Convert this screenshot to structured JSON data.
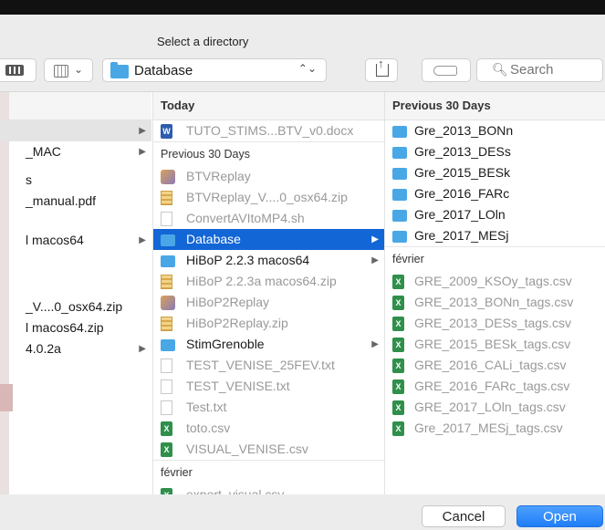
{
  "dialog": {
    "title": "Select a directory"
  },
  "toolbar": {
    "path_label": "Database",
    "search_placeholder": "Search",
    "updown_glyph": "⌃⌄"
  },
  "sidebar": {
    "rows": [
      {
        "label": "",
        "arrow": true
      },
      {
        "label": "_MAC",
        "arrow": true
      },
      {
        "label": "s",
        "arrow": false
      },
      {
        "label": "_manual.pdf",
        "arrow": false
      },
      {
        "label": "l macos64",
        "arrow": true
      },
      {
        "label": "_V....0_osx64.zip",
        "arrow": false
      },
      {
        "label": "l macos64.zip",
        "arrow": false
      },
      {
        "label": "4.0.2a",
        "arrow": true
      }
    ]
  },
  "column1": {
    "header": "Today",
    "today_items": [
      {
        "label": "TUTO_STIMS...BTV_v0.docx",
        "icon": "word-doc-icon",
        "dim": true,
        "arrow": false
      }
    ],
    "section_prev": "Previous 30 Days",
    "prev_items": [
      {
        "label": "BTVReplay",
        "icon": "app-icon",
        "dim": true,
        "arrow": false
      },
      {
        "label": "BTVReplay_V....0_osx64.zip",
        "icon": "zip-icon",
        "dim": true,
        "arrow": false
      },
      {
        "label": "ConvertAVItoMP4.sh",
        "icon": "doc-icon",
        "dim": true,
        "arrow": false
      },
      {
        "label": "Database",
        "icon": "folder-icon",
        "dim": false,
        "arrow": true,
        "selected": true
      },
      {
        "label": "HiBoP 2.2.3 macos64",
        "icon": "folder-icon",
        "dim": false,
        "arrow": true
      },
      {
        "label": "HiBoP 2.2.3a macos64.zip",
        "icon": "zip-icon",
        "dim": true,
        "arrow": false
      },
      {
        "label": "HiBoP2Replay",
        "icon": "app-icon",
        "dim": true,
        "arrow": false
      },
      {
        "label": "HiBoP2Replay.zip",
        "icon": "zip-icon",
        "dim": true,
        "arrow": false
      },
      {
        "label": "StimGrenoble",
        "icon": "folder-icon",
        "dim": false,
        "arrow": true
      },
      {
        "label": "TEST_VENISE_25FEV.txt",
        "icon": "doc-icon",
        "dim": true,
        "arrow": false
      },
      {
        "label": "TEST_VENISE.txt",
        "icon": "doc-icon",
        "dim": true,
        "arrow": false
      },
      {
        "label": "Test.txt",
        "icon": "doc-icon",
        "dim": true,
        "arrow": false
      },
      {
        "label": "toto.csv",
        "icon": "xls-icon",
        "dim": true,
        "arrow": false
      },
      {
        "label": "VISUAL_VENISE.csv",
        "icon": "xls-icon",
        "dim": true,
        "arrow": false
      }
    ],
    "section_fevrier": "février",
    "fevrier_items": [
      {
        "label": "export_visual.csv",
        "icon": "xls-icon",
        "dim": true
      }
    ]
  },
  "column2": {
    "header": "Previous 30 Days",
    "folders": [
      {
        "label": "Gre_2013_BONn"
      },
      {
        "label": "Gre_2013_DESs"
      },
      {
        "label": "Gre_2015_BESk"
      },
      {
        "label": "Gre_2016_FARc"
      },
      {
        "label": "Gre_2017_LOln"
      },
      {
        "label": "Gre_2017_MESj"
      }
    ],
    "section_fevrier": "février",
    "files": [
      {
        "label": "GRE_2009_KSOy_tags.csv"
      },
      {
        "label": "GRE_2013_BONn_tags.csv"
      },
      {
        "label": "GRE_2013_DESs_tags.csv"
      },
      {
        "label": "GRE_2015_BESk_tags.csv"
      },
      {
        "label": "GRE_2016_CALi_tags.csv"
      },
      {
        "label": "GRE_2016_FARc_tags.csv"
      },
      {
        "label": "GRE_2017_LOln_tags.csv"
      },
      {
        "label": "Gre_2017_MESj_tags.csv"
      }
    ]
  },
  "footer": {
    "cancel_label": "Cancel",
    "open_label": "Open"
  },
  "colors": {
    "selection": "#1366d6",
    "folder": "#4aa7e6",
    "open_button": "#1f7df6"
  }
}
